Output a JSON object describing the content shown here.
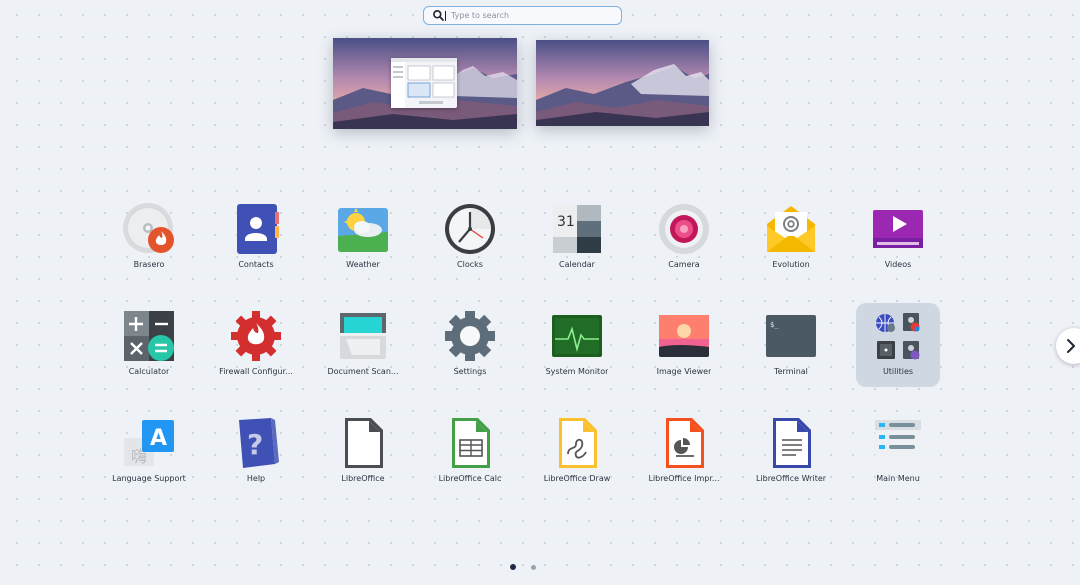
{
  "search": {
    "placeholder": "Type to search",
    "value": ""
  },
  "apps": [
    {
      "label": "Brasero",
      "icon": "brasero-disc-icon"
    },
    {
      "label": "Contacts",
      "icon": "contacts-icon"
    },
    {
      "label": "Weather",
      "icon": "weather-icon"
    },
    {
      "label": "Clocks",
      "icon": "clock-icon"
    },
    {
      "label": "Calendar",
      "icon": "calendar-icon",
      "day": "31"
    },
    {
      "label": "Camera",
      "icon": "camera-icon"
    },
    {
      "label": "Evolution",
      "icon": "mail-envelope-icon"
    },
    {
      "label": "Videos",
      "icon": "video-play-icon"
    },
    {
      "label": "Calculator",
      "icon": "calculator-icon"
    },
    {
      "label": "Firewall Configur...",
      "icon": "firewall-gear-icon"
    },
    {
      "label": "Document Scan...",
      "icon": "scanner-icon"
    },
    {
      "label": "Settings",
      "icon": "gear-icon"
    },
    {
      "label": "System Monitor",
      "icon": "system-monitor-icon"
    },
    {
      "label": "Image Viewer",
      "icon": "image-viewer-icon"
    },
    {
      "label": "Terminal",
      "icon": "terminal-icon",
      "prompt": "$_"
    },
    {
      "label": "Utilities",
      "icon": "utilities-folder-icon"
    },
    {
      "label": "Language Support",
      "icon": "language-support-icon",
      "glyph_a": "A",
      "glyph_b": "嗨"
    },
    {
      "label": "Help",
      "icon": "help-icon",
      "glyph": "?"
    },
    {
      "label": "LibreOffice",
      "icon": "libreoffice-icon"
    },
    {
      "label": "LibreOffice Calc",
      "icon": "libreoffice-calc-icon"
    },
    {
      "label": "LibreOffice Draw",
      "icon": "libreoffice-draw-icon"
    },
    {
      "label": "LibreOffice Impr...",
      "icon": "libreoffice-impress-icon"
    },
    {
      "label": "LibreOffice Writer",
      "icon": "libreoffice-writer-icon"
    },
    {
      "label": "Main Menu",
      "icon": "main-menu-icon"
    }
  ],
  "selected_app": "Utilities",
  "pagination": {
    "pages": 2,
    "current": 1
  },
  "colors": {
    "accent": "#7fb0e0",
    "selected_bg": "#cfd8e2",
    "page_dot_active": "#1f2a44"
  }
}
